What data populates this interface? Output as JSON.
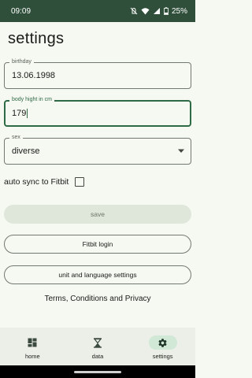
{
  "status_bar": {
    "time": "09:09",
    "battery": "25%"
  },
  "page": {
    "title": "settings"
  },
  "fields": {
    "birthday": {
      "label": "birthday",
      "value": "13.06.1998"
    },
    "height": {
      "label": "body hight in cm",
      "value": "179"
    },
    "sex": {
      "label": "sex",
      "value": "diverse"
    }
  },
  "sync": {
    "label": "auto sync to Fitbit",
    "checked": false
  },
  "buttons": {
    "save": "save",
    "fitbit_login": "Fitbit login",
    "unit_settings": "unit and language settings"
  },
  "terms": "Terms, Conditions and Privacy",
  "nav": {
    "items": [
      {
        "label": "home",
        "icon": "dashboard-icon",
        "active": false
      },
      {
        "label": "data",
        "icon": "hourglass-icon",
        "active": false
      },
      {
        "label": "settings",
        "icon": "gear-icon",
        "active": true
      }
    ]
  },
  "colors": {
    "status_bar": "#2f4f3a",
    "accent": "#2f6a46",
    "background": "#f6f8f2",
    "nav_background": "#ecefe7",
    "active_nav_indicator": "#d0e8d5"
  }
}
